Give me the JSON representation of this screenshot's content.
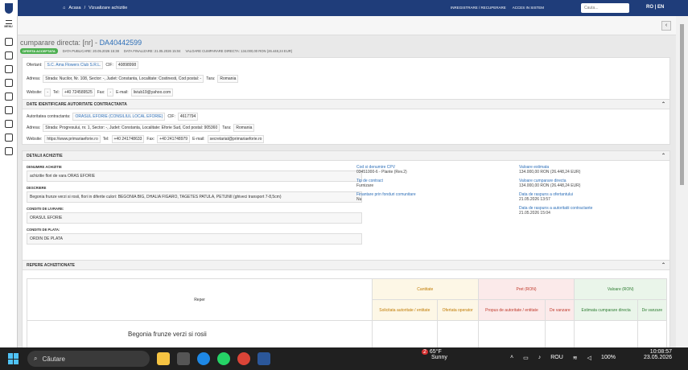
{
  "topbar": {
    "crumb_home": "Acasa",
    "crumb_sep": "/",
    "crumb_page": "Vizualizare achizitie",
    "link_register": "INREGISTRARE / RECUPERARE",
    "link_login": "ACCES IN SISTEM",
    "search_placeholder": "Cauta...",
    "lang": "RO | EN"
  },
  "sidebar": {
    "menu_label": "MENU"
  },
  "header": {
    "title_prefix": "cumparare directa: [nr] -",
    "title_code": "DA40442599",
    "badge": "OFERTA ACCEPTATA",
    "date_pub": "DATA PUBLICARE: 20.05.2026 15:38",
    "date_fin": "DATA FINALIZARE: 21.05.2026 15:04",
    "value": "VALOARE CUMPARARE DIRECTA: 134.000,00 RON (26.448,24 EUR)"
  },
  "ofertant": {
    "l_name": "Ofertant:",
    "name": "S.C. Ama Flowers Club S.R.L.",
    "l_cif": "CIF:",
    "cif": "40898998",
    "l_addr": "Adresa:",
    "addr": "Strada: Nucilor, Nr. 108, Sector: -, Judet: Constanta, Localitate: Costinesti, Cod postal: -",
    "l_tara": "Tara:",
    "tara": "Romania",
    "l_web": "Website:",
    "web": "-",
    "l_tel": "Tel:",
    "tel": "+40 724589525",
    "l_fax": "Fax:",
    "fax": "-",
    "l_mail": "E-mail:",
    "mail": "liviub19@yahoo.com"
  },
  "autoritate": {
    "header": "DATE IDENTIFICARE AUTORITATE CONTRACTANTA",
    "l_name": "Autoritatea contractanta:",
    "name": "ORASUL EFORIE (CONSILIUL LOCAL EFORIE)",
    "l_cif": "CIF:",
    "cif": "4617794",
    "l_addr": "Adresa:",
    "addr": "Strada: Progresului, nr. 1, Sector: -, Judet: Constanta, Localitate: Eforie Sud, Cod postal: 905360",
    "l_tara": "Tara:",
    "tara": "Romania",
    "l_web": "Website:",
    "web": "https://www.primariaeforie.ro",
    "l_tel": "Tel:",
    "tel": "+40 241748633",
    "l_fax": "Fax:",
    "fax": "+40 241748979",
    "l_mail": "E-mail:",
    "mail": "secretariat@primariaeforie.ro"
  },
  "detalii": {
    "header": "DETALII ACHIZITIE",
    "l_den": "DENUMIRE ACHIZITIE",
    "den": "achizitie flori de vara ORAS EFORIE",
    "l_desc": "DESCRIERE",
    "desc": "Begonia frunze verzi si rosii, flori in diferite culori: BEGONIA BIG, DHALIA FIGARO, TAGETES PATULA, PETUNII (ghiveci transport 7-8,5cm)",
    "l_livr": "CONDITII DE LIVRARE:",
    "livr": "ORASUL EFORIE",
    "l_plata": "CONDITII DE PLATA:",
    "plata": "ORDIN DE PLATA",
    "k_cpv": "Cod si denumire CPV",
    "v_cpv": "03451000-6 - Plante (Rev.2)",
    "k_tip": "Tip de contract",
    "v_tip": "Furnizare",
    "k_fin": "Finantare prin fonduri comunitare",
    "v_fin": "Nu",
    "k_est": "Valoare estimata",
    "v_est": "134.000,00 RON (26.448,24 EUR)",
    "k_cd": "Valoare cumparare directa",
    "v_cd": "134.000,00 RON (26.448,24 EUR)",
    "k_ro": "Data de raspuns a ofertantului",
    "v_ro": "21.05.2026 13:57",
    "k_ra": "Data de raspuns a autoritatii contractante",
    "v_ra": "21.05.2026 15:04"
  },
  "repere": {
    "header": "REPERE ACHIZITIONATE",
    "reper": "Reper",
    "cantitate": "Cantitate",
    "pret": "Pret (RON)",
    "valoare": "Valoare (RON)",
    "solicitata": "Solicitata autoritate / entitate",
    "ofertata": "Ofertata operator",
    "propus": "Propus de autoritate / entitate",
    "vanzare": "De vanzare",
    "estimata": "Estimata cumparare directa",
    "vanzare2": "De vanzare",
    "item": "Begonia frunze verzi si rosii"
  },
  "taskbar": {
    "search": "Căutare",
    "weather_temp": "65°F",
    "weather_desc": "Sunny",
    "lang": "ROU",
    "battery": "100%",
    "time": "10:08:57",
    "date": "23.05.2026",
    "notif": "2"
  }
}
